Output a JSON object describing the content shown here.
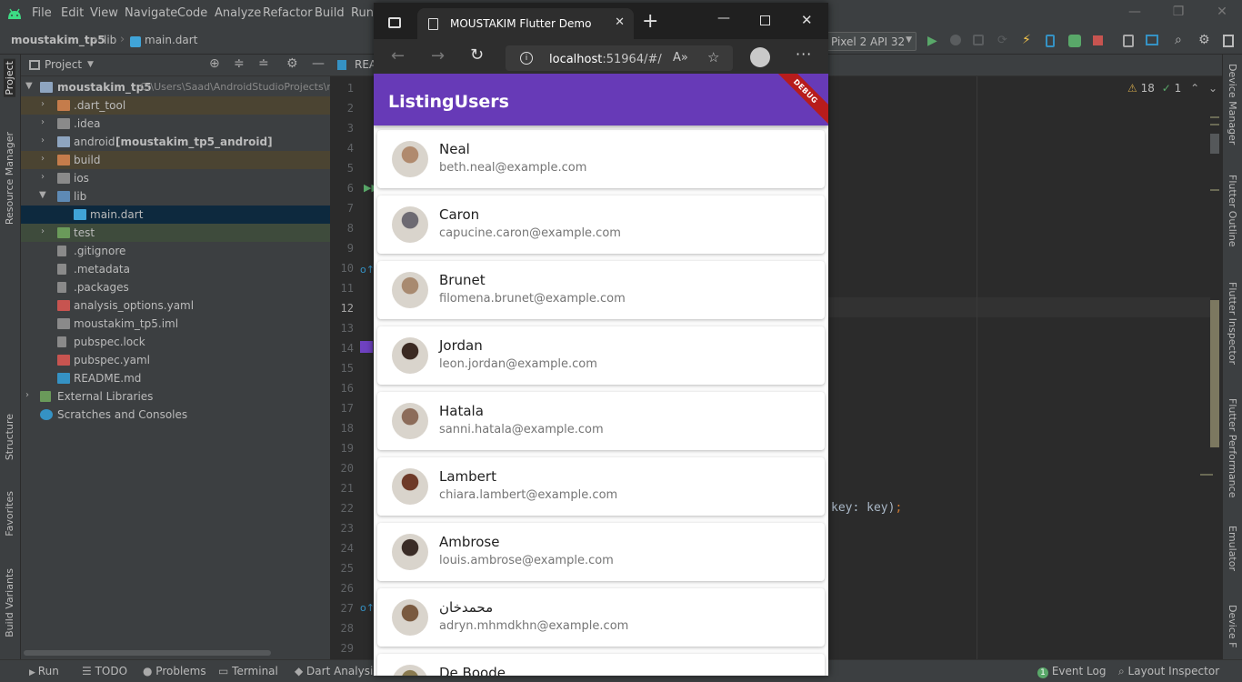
{
  "ide": {
    "menu": [
      "File",
      "Edit",
      "View",
      "Navigate",
      "Code",
      "Analyze",
      "Refactor",
      "Build",
      "Run"
    ],
    "breadcrumb": [
      "moustakim_tp5",
      "lib",
      "main.dart"
    ],
    "device": "Pixel 2 API 32",
    "project_panel": {
      "title": "Project",
      "root": "moustakim_tp5",
      "root_path": "C:\\Users\\Saad\\AndroidStudioProjects\\r",
      "items": [
        {
          "label": ".dart_tool",
          "icon": "folder-excluded-icon"
        },
        {
          "label": ".idea",
          "icon": "folder-settings-icon"
        },
        {
          "label": "android",
          "suffix": "[moustakim_tp5_android]",
          "icon": "folder-module-icon"
        },
        {
          "label": "build",
          "icon": "folder-excluded-icon"
        },
        {
          "label": "ios",
          "icon": "folder-icon"
        },
        {
          "label": "lib",
          "icon": "folder-source-icon"
        },
        {
          "label": "main.dart",
          "icon": "dart-file-icon"
        },
        {
          "label": "test",
          "icon": "folder-test-icon"
        },
        {
          "label": ".gitignore",
          "icon": "text-file-icon"
        },
        {
          "label": ".metadata",
          "icon": "text-file-icon"
        },
        {
          "label": ".packages",
          "icon": "text-file-icon"
        },
        {
          "label": "analysis_options.yaml",
          "icon": "yaml-file-icon"
        },
        {
          "label": "moustakim_tp5.iml",
          "icon": "iml-file-icon"
        },
        {
          "label": "pubspec.lock",
          "icon": "text-file-icon"
        },
        {
          "label": "pubspec.yaml",
          "icon": "yaml-file-icon"
        },
        {
          "label": "README.md",
          "icon": "markdown-file-icon"
        },
        {
          "label": "External Libraries",
          "icon": "library-icon"
        },
        {
          "label": "Scratches and Consoles",
          "icon": "scratches-icon"
        }
      ]
    },
    "left_tabs": [
      "Project",
      "Resource Manager",
      "Structure",
      "Favorites",
      "Build Variants"
    ],
    "right_tabs": [
      "Device Manager",
      "Flutter Outline",
      "Flutter Inspector",
      "Flutter Performance",
      "Emulator",
      "Device F"
    ],
    "editor": {
      "tab": "REA",
      "line_numbers": [
        "1",
        "2",
        "3",
        "4",
        "5",
        "6",
        "7",
        "8",
        "9",
        "10",
        "11",
        "12",
        "13",
        "14",
        "15",
        "16",
        "17",
        "18",
        "19",
        "20",
        "21",
        "22",
        "23",
        "24",
        "25",
        "26",
        "27",
        "28",
        "29"
      ],
      "warnings": "18",
      "weak_warnings": "1",
      "code_fragment": "key: key)",
      "code_fragment_end": ";"
    },
    "statusbar": [
      "Run",
      "TODO",
      "Problems",
      "Terminal",
      "Dart Analysis"
    ],
    "statusbar_right": [
      "Event Log",
      "Layout Inspector"
    ],
    "event_log_count": "1"
  },
  "browser": {
    "tab_title": "MOUSTAKIM Flutter Demo",
    "url_host": "localhost",
    "url_rest": ":51964/#/",
    "app": {
      "title": "ListingUsers",
      "debug_banner": "DEBUG",
      "users": [
        {
          "name": "Neal",
          "email": "beth.neal@example.com",
          "avatar_color": "#b08a6e"
        },
        {
          "name": "Caron",
          "email": "capucine.caron@example.com",
          "avatar_color": "#6d6a72"
        },
        {
          "name": "Brunet",
          "email": "filomena.brunet@example.com",
          "avatar_color": "#a88a70"
        },
        {
          "name": "Jordan",
          "email": "leon.jordan@example.com",
          "avatar_color": "#3b2a22"
        },
        {
          "name": "Hatala",
          "email": "sanni.hatala@example.com",
          "avatar_color": "#8c6c5a"
        },
        {
          "name": "Lambert",
          "email": "chiara.lambert@example.com",
          "avatar_color": "#6e3a28"
        },
        {
          "name": "Ambrose",
          "email": "louis.ambrose@example.com",
          "avatar_color": "#3a2c26"
        },
        {
          "name": "محمدخان",
          "email": "adryn.mhmdkhn@example.com",
          "avatar_color": "#7a5a40"
        },
        {
          "name": "De Boode",
          "email": "",
          "avatar_color": "#8a7a50"
        }
      ]
    }
  }
}
